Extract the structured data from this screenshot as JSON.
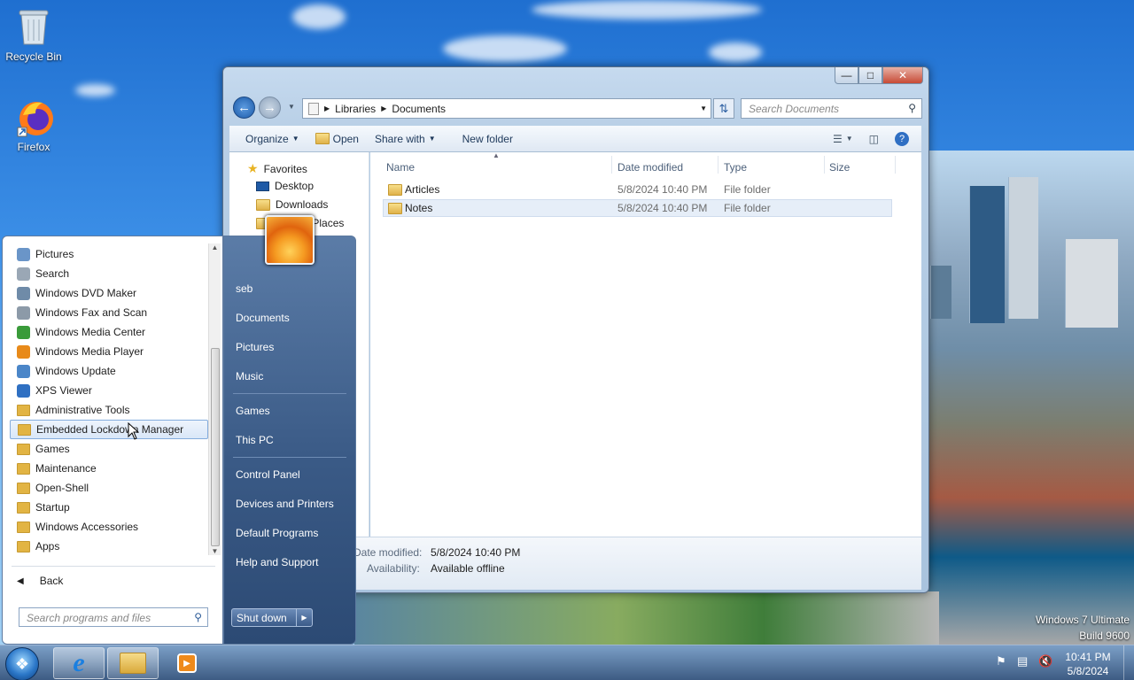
{
  "desktop": {
    "icons": [
      {
        "label": "Recycle Bin"
      },
      {
        "label": "Firefox"
      }
    ],
    "watermark": {
      "line1": "Windows 7 Ultimate",
      "line2": "Build 9600"
    }
  },
  "explorer": {
    "breadcrumb": [
      "Libraries",
      "Documents"
    ],
    "search_placeholder": "Search Documents",
    "toolbar": {
      "organize": "Organize",
      "open": "Open",
      "share_with": "Share with",
      "new_folder": "New folder"
    },
    "nav_pane": {
      "favorites": "Favorites",
      "desktop": "Desktop",
      "downloads": "Downloads",
      "recent_places": "Recent Places"
    },
    "columns": [
      "Name",
      "Date modified",
      "Type",
      "Size"
    ],
    "rows": [
      {
        "name": "Articles",
        "date": "5/8/2024 10:40 PM",
        "type": "File folder",
        "size": ""
      },
      {
        "name": "Notes",
        "date": "5/8/2024 10:40 PM",
        "type": "File folder",
        "size": ""
      }
    ],
    "details": {
      "date_label": "Date modified:",
      "date_value": "5/8/2024 10:40 PM",
      "avail_label": "Availability:",
      "avail_value": "Available offline"
    }
  },
  "start_menu": {
    "programs": [
      {
        "label": "Pictures",
        "icon": "pictures-icon",
        "color": "#6a95c8"
      },
      {
        "label": "Search",
        "icon": "search-icon",
        "color": "#9aa7b5"
      },
      {
        "label": "Windows DVD Maker",
        "icon": "dvd-icon",
        "color": "#6f8ba8"
      },
      {
        "label": "Windows Fax and Scan",
        "icon": "fax-icon",
        "color": "#8c9aa8"
      },
      {
        "label": "Windows Media Center",
        "icon": "media-center-icon",
        "color": "#3a9b3a"
      },
      {
        "label": "Windows Media Player",
        "icon": "media-player-icon",
        "color": "#e88a1a"
      },
      {
        "label": "Windows Update",
        "icon": "windows-update-icon",
        "color": "#4b86c8"
      },
      {
        "label": "XPS Viewer",
        "icon": "xps-icon",
        "color": "#2f70c2"
      },
      {
        "label": "Administrative Tools",
        "icon": "folder-icon",
        "color": "#e2b443"
      },
      {
        "label": "Embedded Lockdown Manager",
        "icon": "folder-icon",
        "color": "#e2b443"
      },
      {
        "label": "Games",
        "icon": "folder-icon",
        "color": "#e2b443"
      },
      {
        "label": "Maintenance",
        "icon": "folder-icon",
        "color": "#e2b443"
      },
      {
        "label": "Open-Shell",
        "icon": "folder-icon",
        "color": "#e2b443"
      },
      {
        "label": "Startup",
        "icon": "folder-icon",
        "color": "#e2b443"
      },
      {
        "label": "Windows Accessories",
        "icon": "folder-icon",
        "color": "#e2b443"
      },
      {
        "label": "Apps",
        "icon": "folder-icon",
        "color": "#e2b443"
      }
    ],
    "back": "Back",
    "search_placeholder": "Search programs and files",
    "right_items": [
      {
        "label": "seb"
      },
      {
        "label": "Documents"
      },
      {
        "label": "Pictures"
      },
      {
        "label": "Music"
      },
      {
        "label": "Games"
      },
      {
        "label": "This PC"
      },
      {
        "label": "Control Panel"
      },
      {
        "label": "Devices and Printers"
      },
      {
        "label": "Default Programs"
      },
      {
        "label": "Help and Support"
      }
    ],
    "shutdown": "Shut down"
  },
  "taskbar": {
    "time": "10:41 PM",
    "date": "5/8/2024"
  }
}
